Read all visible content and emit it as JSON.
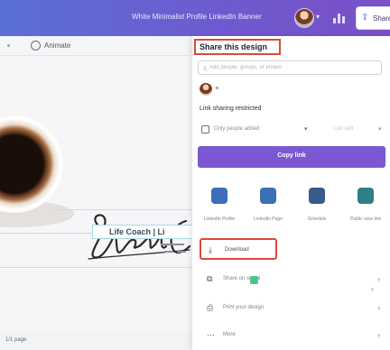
{
  "topbar": {
    "design_title": "White Minimalist Profile LinkedIn Banner",
    "share_label": "Share",
    "share_icon": "upload-icon",
    "chart_icon": "bar-chart-icon"
  },
  "subtoolbar": {
    "animate_label": "Animate"
  },
  "canvas": {
    "name_text": "Life Coach | Li",
    "page_count": "1/1 page"
  },
  "share_panel": {
    "title": "Share this design",
    "people_placeholder": "Add people, groups, or emails",
    "link_sharing_label": "Link sharing restricted",
    "access_label": "Only people added",
    "permission_label": "Can edit",
    "copy_link_label": "Copy link",
    "share_options": [
      {
        "label": "LinkedIn Profile",
        "icon": "linkedin-profile-icon",
        "color": "#3b6fb6"
      },
      {
        "label": "LinkedIn Page",
        "icon": "linkedin-page-icon",
        "color": "#3b6fb6"
      },
      {
        "label": "Schedule",
        "icon": "calendar-icon",
        "color": "#3a5a8c"
      },
      {
        "label": "Public view link",
        "icon": "link-icon",
        "color": "#2e7f86"
      }
    ],
    "rows": [
      {
        "label": "Download",
        "icon": "download-icon"
      },
      {
        "label": "Share on social",
        "icon": "share-social-icon"
      },
      {
        "label": "Print your design",
        "icon": "print-icon"
      },
      {
        "label": "More",
        "icon": "more-icon"
      }
    ]
  },
  "colors": {
    "topbar_start": "#5a6fd6",
    "topbar_end": "#7b4fc6",
    "copy_link_button": "#7b57d3",
    "highlight_box": "#e0483c"
  }
}
